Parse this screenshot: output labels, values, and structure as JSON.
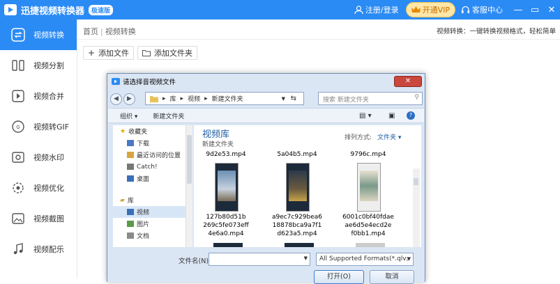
{
  "titlebar": {
    "app_title": "迅捷视频转换器",
    "badge": "极速版",
    "login": "注册/登录",
    "vip": "开通VIP",
    "service": "客服中心",
    "min": "—",
    "max": "▭",
    "close": "✕"
  },
  "sidebar": {
    "items": [
      {
        "label": "视频转换",
        "icon": "convert-icon"
      },
      {
        "label": "视频分割",
        "icon": "split-icon"
      },
      {
        "label": "视频合并",
        "icon": "merge-icon"
      },
      {
        "label": "视频转GIF",
        "icon": "gif-icon"
      },
      {
        "label": "视频水印",
        "icon": "watermark-icon"
      },
      {
        "label": "视频优化",
        "icon": "optimize-icon"
      },
      {
        "label": "视频截图",
        "icon": "screenshot-icon"
      },
      {
        "label": "视频配乐",
        "icon": "music-icon"
      }
    ]
  },
  "main": {
    "breadcrumb": [
      "首页",
      "视频转换"
    ],
    "hint": "视频转换：一键转换视频格式，轻松简单",
    "add_file": "添加文件",
    "add_folder": "添加文件夹"
  },
  "dialog": {
    "title": "请选择音视频文件",
    "close": "✕",
    "address": [
      "库",
      "视频",
      "新建文件夹"
    ],
    "search_placeholder": "搜索 新建文件夹",
    "organize": "组织 ▾",
    "new_folder": "新建文件夹",
    "nav": {
      "favorites": "收藏夹",
      "fav_items": [
        "下载",
        "最近访问的位置",
        "Catch!",
        "桌面"
      ],
      "library": "库",
      "lib_items": [
        "视频",
        "图片",
        "文档"
      ]
    },
    "library_title": "视频库",
    "library_sub": "新建文件夹",
    "arrange_label": "排列方式:",
    "arrange_value": "文件夹 ▾",
    "files_top": [
      "9d2e53.mp4",
      "5a04b5.mp4",
      "9796c.mp4"
    ],
    "files": [
      [
        "127b80d51b",
        "269c5fe073eff",
        "4e6a0.mp4"
      ],
      [
        "a9ec7c929bea6",
        "18878bca9a7f1",
        "d623a5.mp4"
      ],
      [
        "6001c0bf40fdae",
        "ae6d5e4ecd2e",
        "f0bb1.mp4"
      ]
    ],
    "filename_label": "文件名(N):",
    "filter": "All Supported Formats(*.qlv;",
    "open": "打开(O)",
    "cancel": "取消"
  },
  "colors": {
    "accent": "#2b8bf5",
    "vip_bg": "#ffe7a8"
  }
}
